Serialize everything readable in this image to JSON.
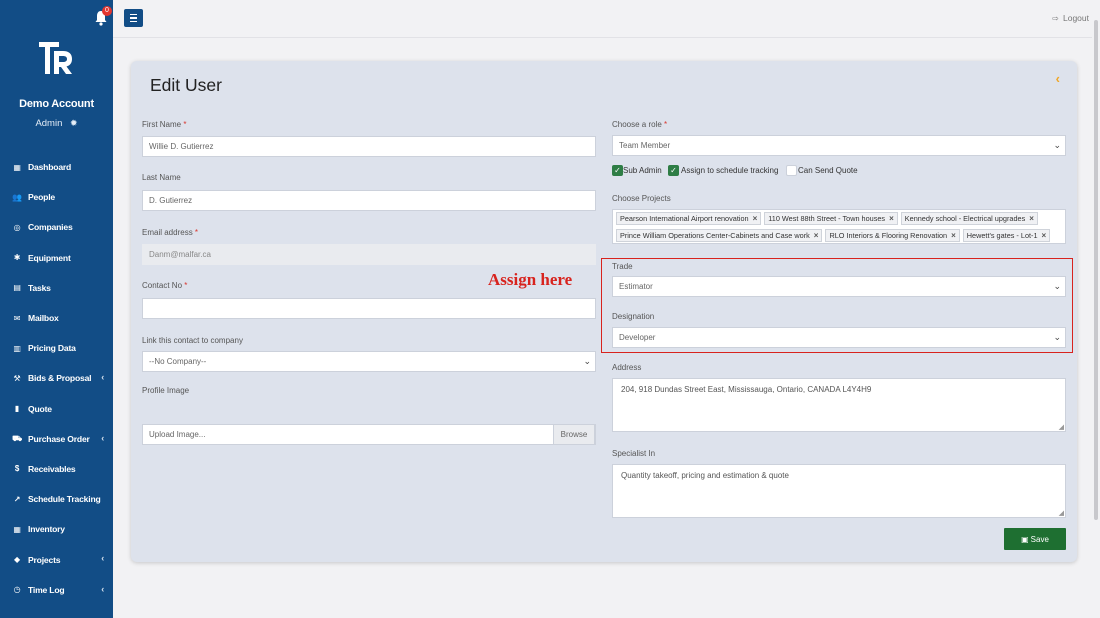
{
  "sidebar": {
    "notification_count": "0",
    "account_name": "Demo Account",
    "account_role": "Admin",
    "items": [
      {
        "label": "Dashboard",
        "icon": "dashboard-icon",
        "glyph": "▦",
        "chevron": false
      },
      {
        "label": "People",
        "icon": "people-icon",
        "glyph": "👥",
        "chevron": false
      },
      {
        "label": "Companies",
        "icon": "handshake-icon",
        "glyph": "◎",
        "chevron": false
      },
      {
        "label": "Equipment",
        "icon": "gear-icon",
        "glyph": "✱",
        "chevron": false
      },
      {
        "label": "Tasks",
        "icon": "tasks-icon",
        "glyph": "▤",
        "chevron": false
      },
      {
        "label": "Mailbox",
        "icon": "envelope-icon",
        "glyph": "✉",
        "chevron": false
      },
      {
        "label": "Pricing Data",
        "icon": "database-icon",
        "glyph": "▥",
        "chevron": false
      },
      {
        "label": "Bids & Proposal",
        "icon": "gavel-icon",
        "glyph": "⚒",
        "chevron": true
      },
      {
        "label": "Quote",
        "icon": "file-icon",
        "glyph": "▮",
        "chevron": false
      },
      {
        "label": "Purchase Order",
        "icon": "cart-icon",
        "glyph": "⛟",
        "chevron": true
      },
      {
        "label": "Receivables",
        "icon": "dollar-icon",
        "glyph": "$",
        "chevron": false
      },
      {
        "label": "Schedule Tracking",
        "icon": "line-chart-icon",
        "glyph": "↗",
        "chevron": false
      },
      {
        "label": "Inventory",
        "icon": "inventory-icon",
        "glyph": "▦",
        "chevron": false
      },
      {
        "label": "Projects",
        "icon": "diamond-icon",
        "glyph": "◆",
        "chevron": true
      },
      {
        "label": "Time Log",
        "icon": "clock-icon",
        "glyph": "◷",
        "chevron": true
      }
    ]
  },
  "topbar": {
    "logout_label": "Logout"
  },
  "form": {
    "title": "Edit User",
    "first_name": {
      "label": "First Name",
      "required": "*",
      "value": "Willie D. Gutierrez"
    },
    "last_name": {
      "label": "Last Name",
      "value": "D. Gutierrez"
    },
    "email": {
      "label": "Email address",
      "required": "*",
      "value": "Danm@malfar.ca"
    },
    "contact_no": {
      "label": "Contact No",
      "required": "*",
      "value": ""
    },
    "company": {
      "label": "Link this contact to company",
      "value": "--No Company--"
    },
    "profile_image": {
      "label": "Profile Image",
      "placeholder": "Upload Image...",
      "browse_label": "Browse"
    },
    "role": {
      "label": "Choose a role",
      "required": "*",
      "value": "Team Member"
    },
    "checkboxes": [
      {
        "label": "Sub Admin",
        "checked": true
      },
      {
        "label": "Assign to schedule tracking",
        "checked": true
      },
      {
        "label": "Can Send Quote",
        "checked": false
      }
    ],
    "projects": {
      "label": "Choose Projects",
      "tags": [
        "Pearson International Airport renovation",
        "110 West 88th Street - Town houses",
        "Kennedy school - Electrical upgrades",
        "Prince William Operations Center-Cabinets and Case work",
        "RLO Interiors & Flooring Renovation",
        "Hewett's gates - Lot-1"
      ]
    },
    "trade": {
      "label": "Trade",
      "value": "Estimator"
    },
    "designation": {
      "label": "Designation",
      "value": "Developer"
    },
    "address": {
      "label": "Address",
      "value": "204, 918 Dundas Street East, Mississauga, Ontario, CANADA L4Y4H9"
    },
    "specialist": {
      "label": "Specialist In",
      "value": "Quantity takeoff, pricing and estimation & quote"
    },
    "save_label": "Save"
  },
  "annotation": {
    "text": "Assign here",
    "color": "#d8231e"
  },
  "colors": {
    "sidebar": "#124d86",
    "save_button": "#1e6f31",
    "checkbox_checked": "#2e7d45",
    "accent_chevron": "#f0a624"
  }
}
